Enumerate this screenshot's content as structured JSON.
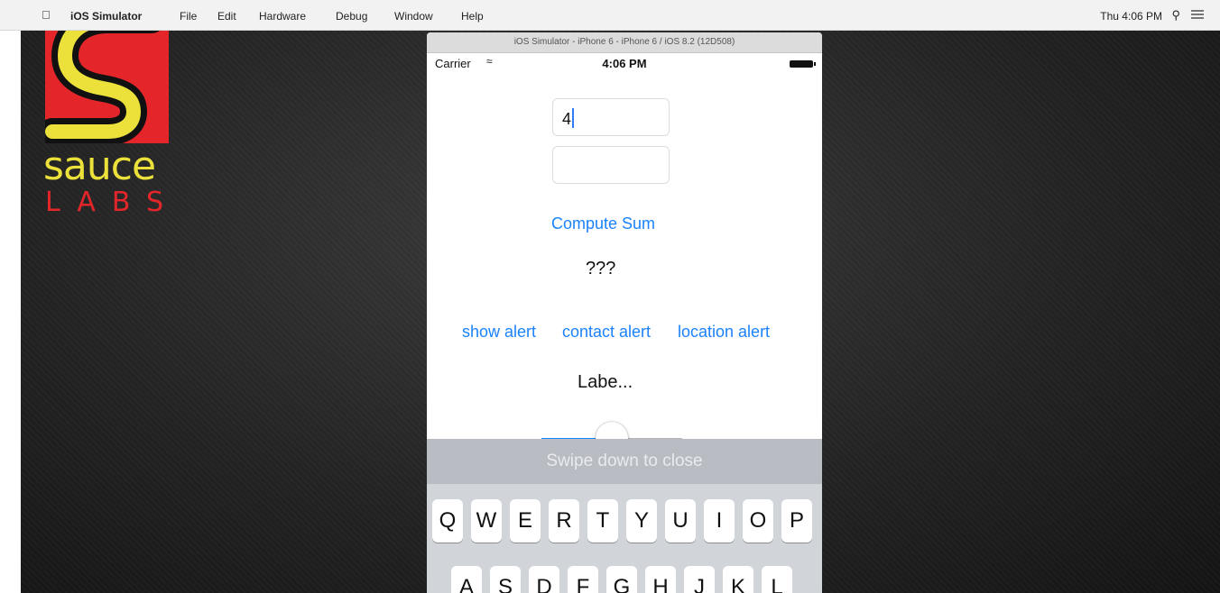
{
  "menubar": {
    "app_name": "iOS Simulator",
    "items": [
      "File",
      "Edit",
      "Hardware",
      "Debug",
      "Window",
      "Help"
    ],
    "clock": "Thu 4:06 PM"
  },
  "logo": {
    "word_top": "sauce",
    "word_bottom": "LABS"
  },
  "simulator": {
    "window_title": "iOS Simulator - iPhone 6 - iPhone 6 / iOS 8.2 (12D508)",
    "status": {
      "carrier": "Carrier",
      "time": "4:06 PM"
    },
    "field_a": {
      "value": "4"
    },
    "field_b": {
      "value": ""
    },
    "compute_button": "Compute Sum",
    "result_label": "???",
    "alerts": {
      "show": "show alert",
      "contact": "contact alert",
      "location": "location alert"
    },
    "slider_label": "Labe...",
    "slider_value": 0.5,
    "swipe_hint": "Swipe down to close",
    "keyboard": {
      "row1": [
        "Q",
        "W",
        "E",
        "R",
        "T",
        "Y",
        "U",
        "I",
        "O",
        "P"
      ],
      "row2": [
        "A",
        "S",
        "D",
        "F",
        "G",
        "H",
        "J",
        "K",
        "L"
      ]
    }
  },
  "colors": {
    "accent": "#1a82fb",
    "logo_red": "#e4262b",
    "logo_yellow": "#ebe13a"
  }
}
